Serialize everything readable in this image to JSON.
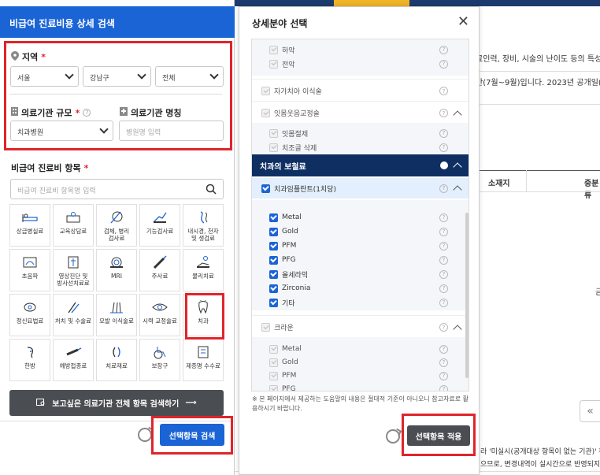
{
  "background": {
    "text_line1": "료인력, 장비, 시술의 난이도 등의 특성",
    "text_line2": "간(7월~9월)입니다. 2023년 공개일(9.",
    "col1": "소재지",
    "col2": "중분류",
    "side_char": "금",
    "footer1": "라 '미실시(공개대상 항목이 없는 기관)' 확인",
    "footer2": "으므로, 변경내역이 실시간으로 반영되지 않",
    "prev_icon": "«"
  },
  "left_panel": {
    "title": "비급여 진료비용 상세 검색",
    "region": {
      "label": "지역",
      "required_mark": "*",
      "selects": [
        "서울",
        "강남구",
        "전체"
      ]
    },
    "scale": {
      "label": "의료기관 규모",
      "required_mark": "*",
      "help_mark": "?",
      "value": "치과병원"
    },
    "name": {
      "label": "의료기관 명칭",
      "placeholder": "병원명 입력"
    },
    "items": {
      "label": "비급여 진료비 항목",
      "required_mark": "*",
      "placeholder": "비급여 진료비 항목명 입력"
    },
    "categories": [
      {
        "label": "상급병실료",
        "icon": "hospital-bed-icon"
      },
      {
        "label": "교육상담료",
        "icon": "consultation-icon"
      },
      {
        "label": "검체, 병리\n검사료",
        "icon": "specimen-test-icon"
      },
      {
        "label": "기능검사료",
        "icon": "function-test-icon"
      },
      {
        "label": "내시경, 천자\n및 생검료",
        "icon": "endoscope-icon"
      },
      {
        "label": "초음파",
        "icon": "ultrasound-icon"
      },
      {
        "label": "영상진단 및\n방사선치료료",
        "icon": "radiology-icon"
      },
      {
        "label": "MRI",
        "icon": "mri-icon"
      },
      {
        "label": "주사료",
        "icon": "injection-icon"
      },
      {
        "label": "물리치료",
        "icon": "physical-therapy-icon"
      },
      {
        "label": "정신요법료",
        "icon": "psychotherapy-icon"
      },
      {
        "label": "처치 및 수술료",
        "icon": "surgery-icon"
      },
      {
        "label": "모발 이식술료",
        "icon": "hair-transplant-icon"
      },
      {
        "label": "시력 교정술료",
        "icon": "vision-correction-icon"
      },
      {
        "label": "치과",
        "icon": "tooth-icon"
      },
      {
        "label": "한방",
        "icon": "oriental-medicine-icon"
      },
      {
        "label": "예방접종료",
        "icon": "vaccine-icon"
      },
      {
        "label": "치료재료",
        "icon": "treatment-material-icon"
      },
      {
        "label": "보장구",
        "icon": "wheelchair-icon"
      },
      {
        "label": "제증명 수수료",
        "icon": "certificate-icon"
      }
    ],
    "search_all_button": "보고싶은 의료기관 전체 항목 검색하기",
    "search_all_arrow": "⟶",
    "submit_button": "선택항목 검색"
  },
  "modal": {
    "title": "상세분야 선택",
    "close": "✕",
    "rows_top": [
      {
        "label": "하악",
        "state": "disabled",
        "indent": true
      },
      {
        "label": "전악",
        "state": "disabled",
        "indent": true
      },
      {
        "label": "자가치아 이식술",
        "state": "disabled",
        "indent": false
      },
      {
        "label": "잇몸웃음교정술",
        "state": "disabled",
        "indent": false,
        "expand": true
      },
      {
        "label": "잇몸절제",
        "state": "disabled",
        "indent": true
      },
      {
        "label": "치조골 삭제",
        "state": "disabled",
        "indent": true
      }
    ],
    "section_title": "치과의 보철료",
    "implant": {
      "label": "치과임플란트(1치당)"
    },
    "implant_items": [
      "Metal",
      "Gold",
      "PFM",
      "PFG",
      "올세라믹",
      "Zirconia",
      "기타"
    ],
    "crown": {
      "label": "크라운"
    },
    "crown_items": [
      "Metal",
      "Gold",
      "PFM",
      "PFG"
    ],
    "help_mark": "?",
    "notice": "※ 본 페이지에서 제공하는 도움말의 내용은 절대적 기준이 아니오니 참고자료로 활용하시기 바랍니다.",
    "apply_button": "선택항목 적용"
  },
  "colors": {
    "brand_blue": "#1a64d6",
    "navy": "#0f2f63",
    "highlight_red": "#e0242b",
    "dark_button": "#4a4d52"
  }
}
